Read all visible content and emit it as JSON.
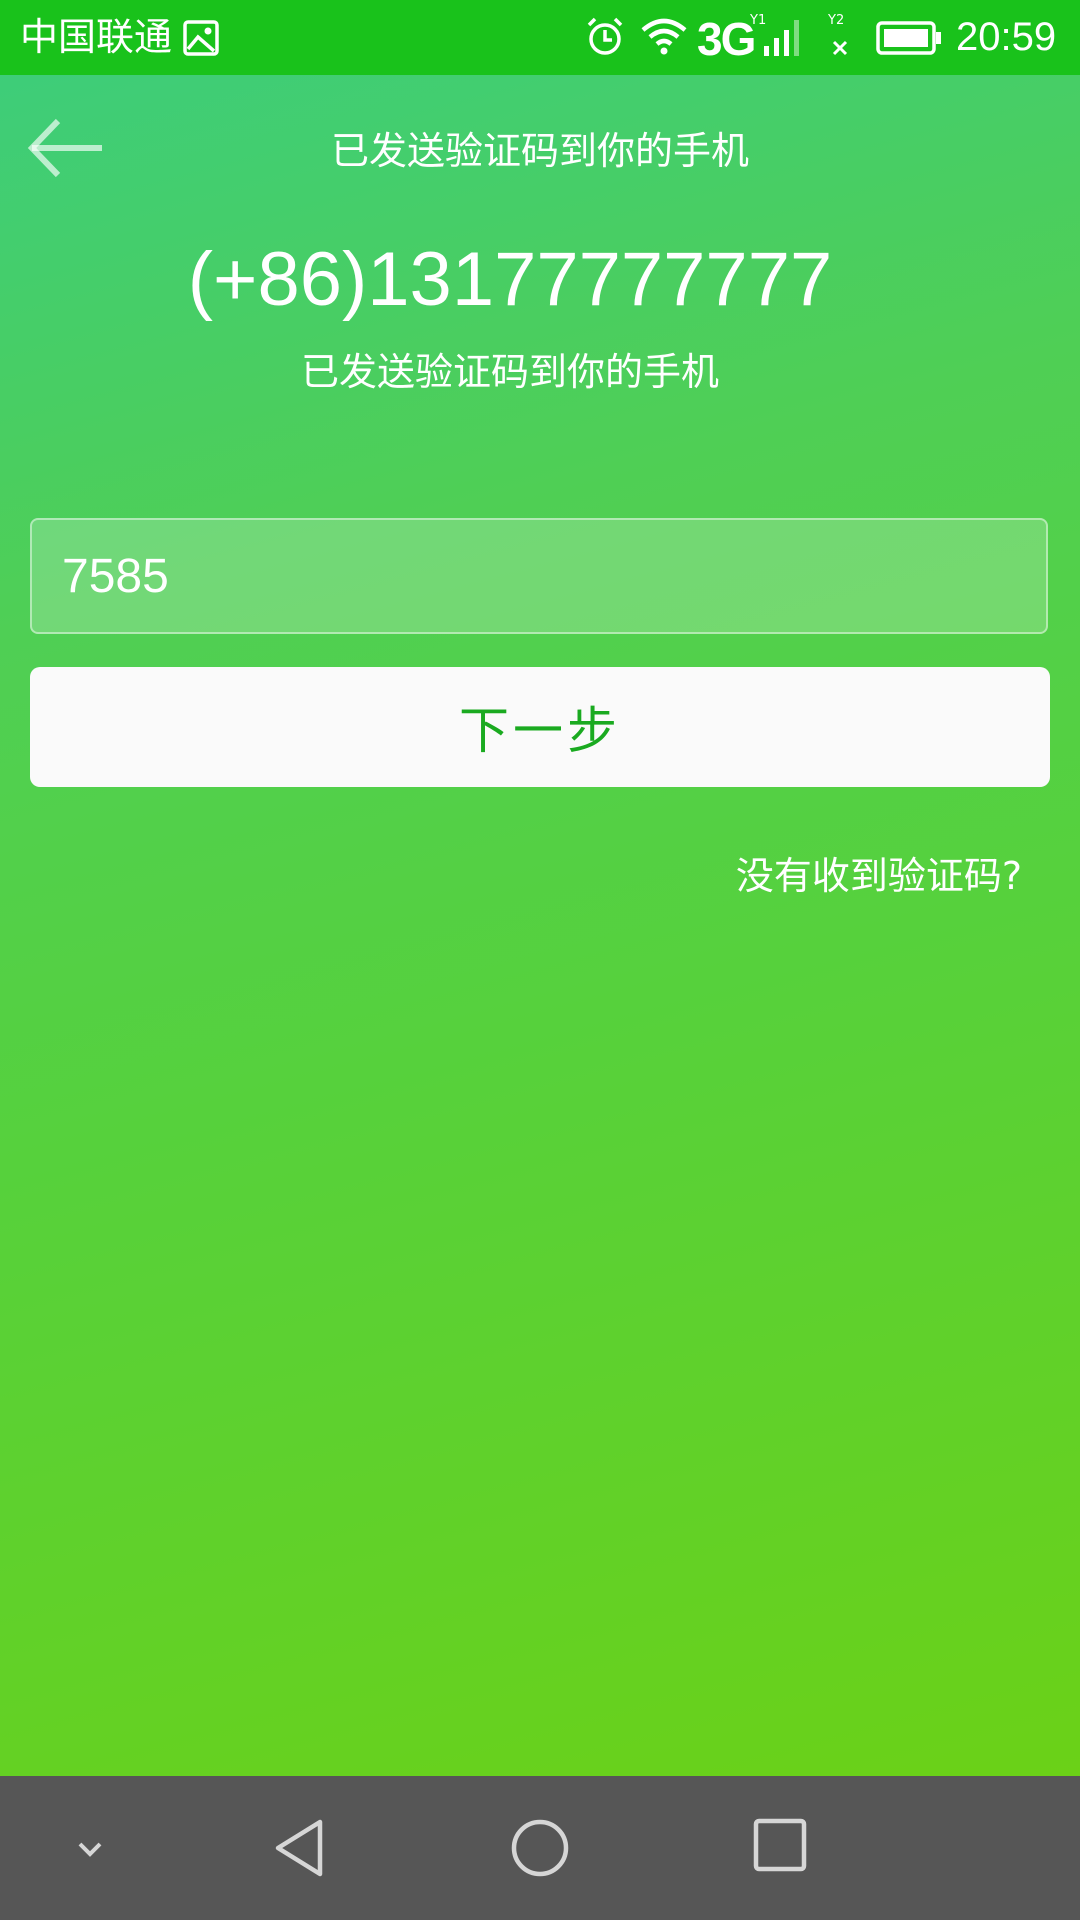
{
  "status_bar": {
    "carrier": "中国联通",
    "network": "3G",
    "time": "20:59",
    "icons": [
      "gallery-icon",
      "alarm-icon",
      "wifi-icon",
      "signal-sim1-icon",
      "signal-sim2-icon",
      "battery-icon"
    ]
  },
  "header": {
    "back_icon": "arrow-left-icon",
    "title": "已发送验证码到你的手机"
  },
  "verification": {
    "phone": "(+86)13177777777",
    "sub_text": "已发送验证码到你的手机"
  },
  "code_input": {
    "value": "7585"
  },
  "next_button": {
    "label": "下一步"
  },
  "no_code_link": {
    "label": "没有收到验证码?"
  },
  "nav_bar": {
    "icons": [
      "chevron-down-icon",
      "nav-back-icon",
      "nav-home-icon",
      "nav-recent-icon"
    ]
  },
  "colors": {
    "status_bar": "#19c21b",
    "gradient_start": "#3ecd79",
    "gradient_end": "#6bd117",
    "button_text": "#1aaa20",
    "nav_bar": "#565656"
  }
}
